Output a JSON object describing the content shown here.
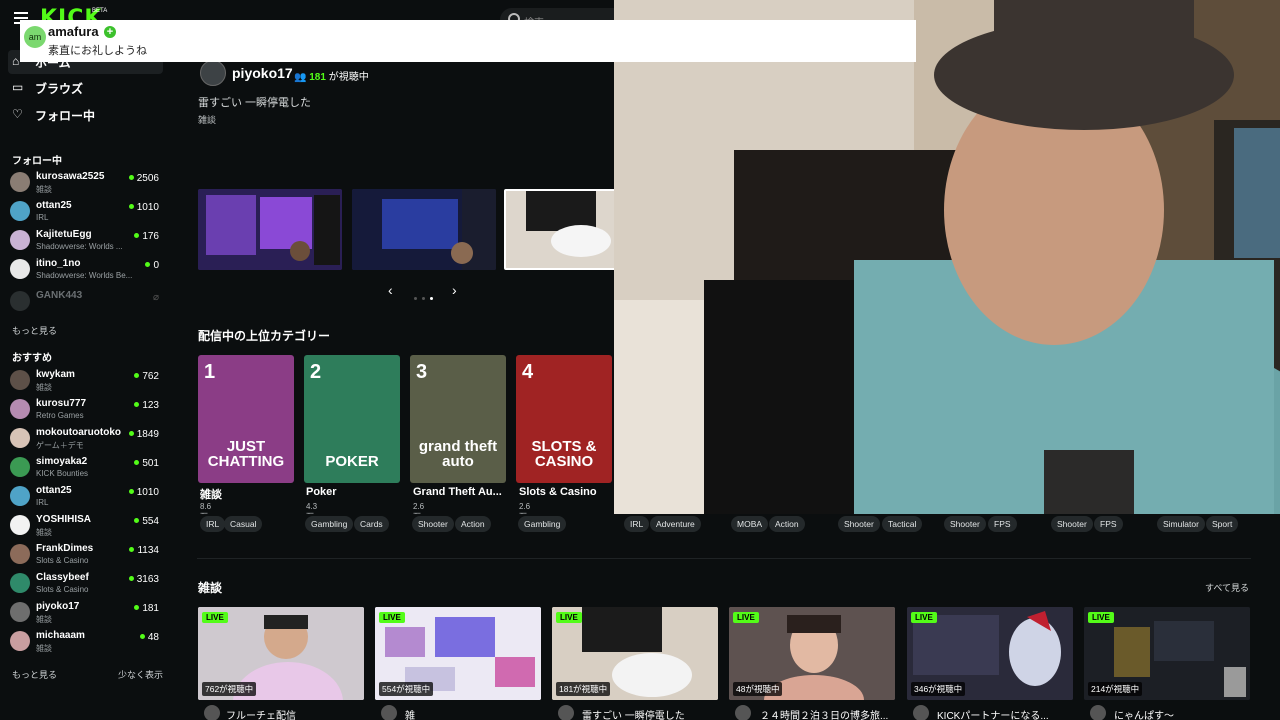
{
  "header": {
    "logo": "KICK",
    "logo_badge": "BETA",
    "search_placeholder": "検索"
  },
  "notification": {
    "avatar": "am",
    "username": "amafura",
    "plus_icon": "+",
    "message": "素直にお礼しようね"
  },
  "sidebar": {
    "nav": [
      {
        "label": "ホーム",
        "icon": "home-icon",
        "glyph": "⌂"
      },
      {
        "label": "ブラウズ",
        "icon": "browse-icon",
        "glyph": "▭"
      },
      {
        "label": "フォロー中",
        "icon": "heart-icon",
        "glyph": "♡"
      }
    ],
    "following_title": "フォロー中",
    "following": [
      {
        "name": "kurosawa2525",
        "category": "雑談",
        "viewers": "2506"
      },
      {
        "name": "ottan25",
        "category": "IRL",
        "viewers": "1010"
      },
      {
        "name": "KajitetuEgg",
        "category": "Shadowverse: Worlds ...",
        "viewers": "176"
      },
      {
        "name": "itino_1no",
        "category": "Shadowverse: Worlds Be...",
        "viewers": "0"
      },
      {
        "name": "GANK443",
        "category": "",
        "viewers": ""
      }
    ],
    "show_more": "もっと見る",
    "recommended_title": "おすすめ",
    "recommended": [
      {
        "name": "kwykam",
        "category": "雑談",
        "viewers": "762"
      },
      {
        "name": "kurosu777",
        "category": "Retro Games",
        "viewers": "123"
      },
      {
        "name": "mokoutoaruotoko",
        "category": "ゲーム＋デモ",
        "viewers": "1849"
      },
      {
        "name": "simoyaka2",
        "category": "KICK Bounties",
        "viewers": "501"
      },
      {
        "name": "ottan25",
        "category": "IRL",
        "viewers": "1010"
      },
      {
        "name": "YOSHIHISA",
        "category": "雑談",
        "viewers": "554"
      },
      {
        "name": "FrankDimes",
        "category": "Slots & Casino",
        "viewers": "1134"
      },
      {
        "name": "Classybeef",
        "category": "Slots & Casino",
        "viewers": "3163"
      },
      {
        "name": "piyoko17",
        "category": "雑談",
        "viewers": "181"
      },
      {
        "name": "michaaam",
        "category": "雑談",
        "viewers": "48"
      }
    ],
    "show_more_2": "もっと見る",
    "show_less": "少なく表示"
  },
  "featured": {
    "streamer": "piyoko17",
    "viewer_icon": "👥",
    "viewers": "181",
    "viewers_suffix": "が視聴中",
    "title": "雷すごい 一瞬停電した",
    "tag": "雑談"
  },
  "categories_title": "配信中の上位カテゴリー",
  "categories": [
    {
      "rank": "1",
      "art": "JUST CHATTING",
      "name": "雑談",
      "viewers": "8.6万が視聴中",
      "color": "#8b3d86"
    },
    {
      "rank": "2",
      "art": "POKER",
      "name": "Poker",
      "viewers": "4.3万が視聴中",
      "color": "#2e7d5b"
    },
    {
      "rank": "3",
      "art": "grand theft auto",
      "name": "Grand Theft Au...",
      "viewers": "2.6万が視聴中",
      "color": "#5a5e48"
    },
    {
      "rank": "4",
      "art": "SLOTS & CASINO",
      "name": "Slots & Casino",
      "viewers": "2.6万が視聴中",
      "color": "#a02323"
    }
  ],
  "tags": [
    "IRL",
    "Casual",
    "Gambling",
    "Cards",
    "Shooter",
    "Action",
    "Gambling",
    "IRL",
    "Adventure",
    "MOBA",
    "Action",
    "Shooter",
    "Tactical",
    "Shooter",
    "FPS",
    "Shooter",
    "FPS",
    "Simulator",
    "Sport"
  ],
  "zatsu_title": "雑談",
  "see_all": "すべて見る",
  "live_label": "LIVE",
  "streams": [
    {
      "viewers": "762が視聴中",
      "title": "フルーチェ配信",
      "color": "#c9c3c8"
    },
    {
      "viewers": "554が視聴中",
      "title": "雑",
      "color": "#e7e4f0"
    },
    {
      "viewers": "181が視聴中",
      "title": "雷すごい 一瞬停電した",
      "color": "#cfc8bd"
    },
    {
      "viewers": "48が視聴中",
      "title": "２４時間２泊３日の博多旅...",
      "color": "#6a5e5c"
    },
    {
      "viewers": "346が視聴中",
      "title": "KICKパートナーになる...",
      "color": "#2d2a3f"
    },
    {
      "viewers": "214が視聴中",
      "title": "にゃんぱす〜",
      "color": "#1e2127"
    }
  ]
}
